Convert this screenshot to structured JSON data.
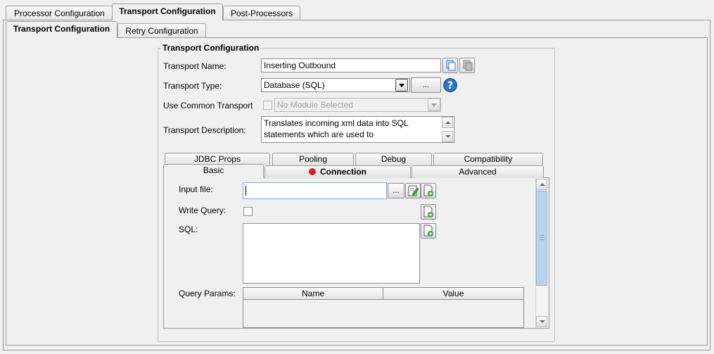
{
  "top_tabs": [
    {
      "label": "Processor Configuration",
      "active": false
    },
    {
      "label": "Transport Configuration",
      "active": true
    },
    {
      "label": "Post-Processors",
      "active": false
    }
  ],
  "sub_tabs": [
    {
      "label": "Transport Configuration",
      "active": true
    },
    {
      "label": "Retry Configuration",
      "active": false
    }
  ],
  "group": {
    "title": "Transport Configuration",
    "name_label": "Transport Name:",
    "name_value": "Inserting Outbound",
    "type_label": "Transport Type:",
    "type_value": "Database (SQL)",
    "browse_label": "...",
    "common_label": "Use Common Transport",
    "common_placeholder": "No Module Selected",
    "desc_label": "Transport Description:",
    "desc_value": "Translates incoming xml data into SQL statements which are used to"
  },
  "props_tabs_back": [
    "JDBC Props",
    "Pooling",
    "Debug",
    "Compatibility"
  ],
  "props_tabs_front": [
    "Basic",
    "Connection",
    "Advanced"
  ],
  "basic": {
    "input_file_label": "Input file:",
    "input_file_value": "",
    "browse_label": "...",
    "write_query_label": "Write Query:",
    "sql_label": "SQL:",
    "sql_value": "",
    "query_params_label": "Query Params:",
    "columns": [
      "Name",
      "Value"
    ]
  },
  "colors": {
    "error_dot": "#d81e1e",
    "help_icon": "#1f5fa8",
    "scroll_thumb": "#b9d4f0"
  }
}
